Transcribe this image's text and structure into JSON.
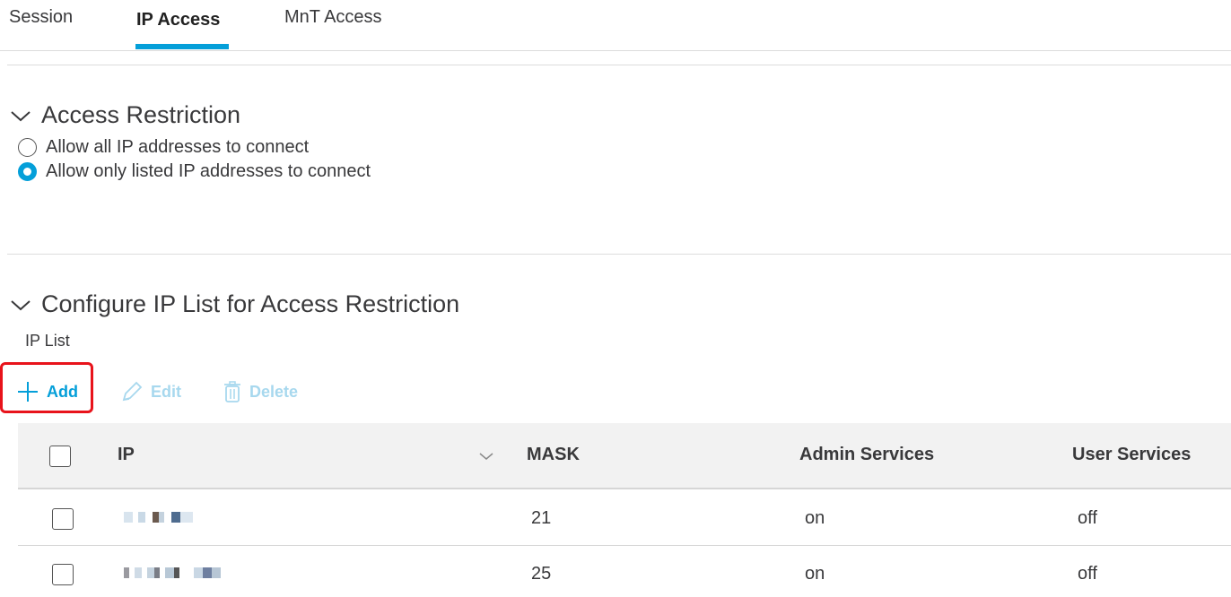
{
  "tabs": [
    {
      "label": "Session",
      "active": false
    },
    {
      "label": "IP Access",
      "active": true
    },
    {
      "label": "MnT Access",
      "active": false
    }
  ],
  "accent_color": "#049fd9",
  "highlight_color": "#e8131b",
  "access_restriction": {
    "title": "Access Restriction",
    "options": [
      {
        "label": "Allow all IP addresses to connect",
        "selected": false
      },
      {
        "label": "Allow only listed IP addresses to connect",
        "selected": true
      }
    ]
  },
  "ip_list_section": {
    "title": "Configure IP List for Access Restriction",
    "list_label": "IP List",
    "toolbar": {
      "add_label": "Add",
      "edit_label": "Edit",
      "delete_label": "Delete"
    },
    "columns": {
      "ip": "IP",
      "mask": "MASK",
      "admin_services": "Admin Services",
      "user_services": "User Services"
    },
    "rows": [
      {
        "mask": "21",
        "admin_services": "on",
        "user_services": "off"
      },
      {
        "mask": "25",
        "admin_services": "on",
        "user_services": "off"
      }
    ]
  }
}
